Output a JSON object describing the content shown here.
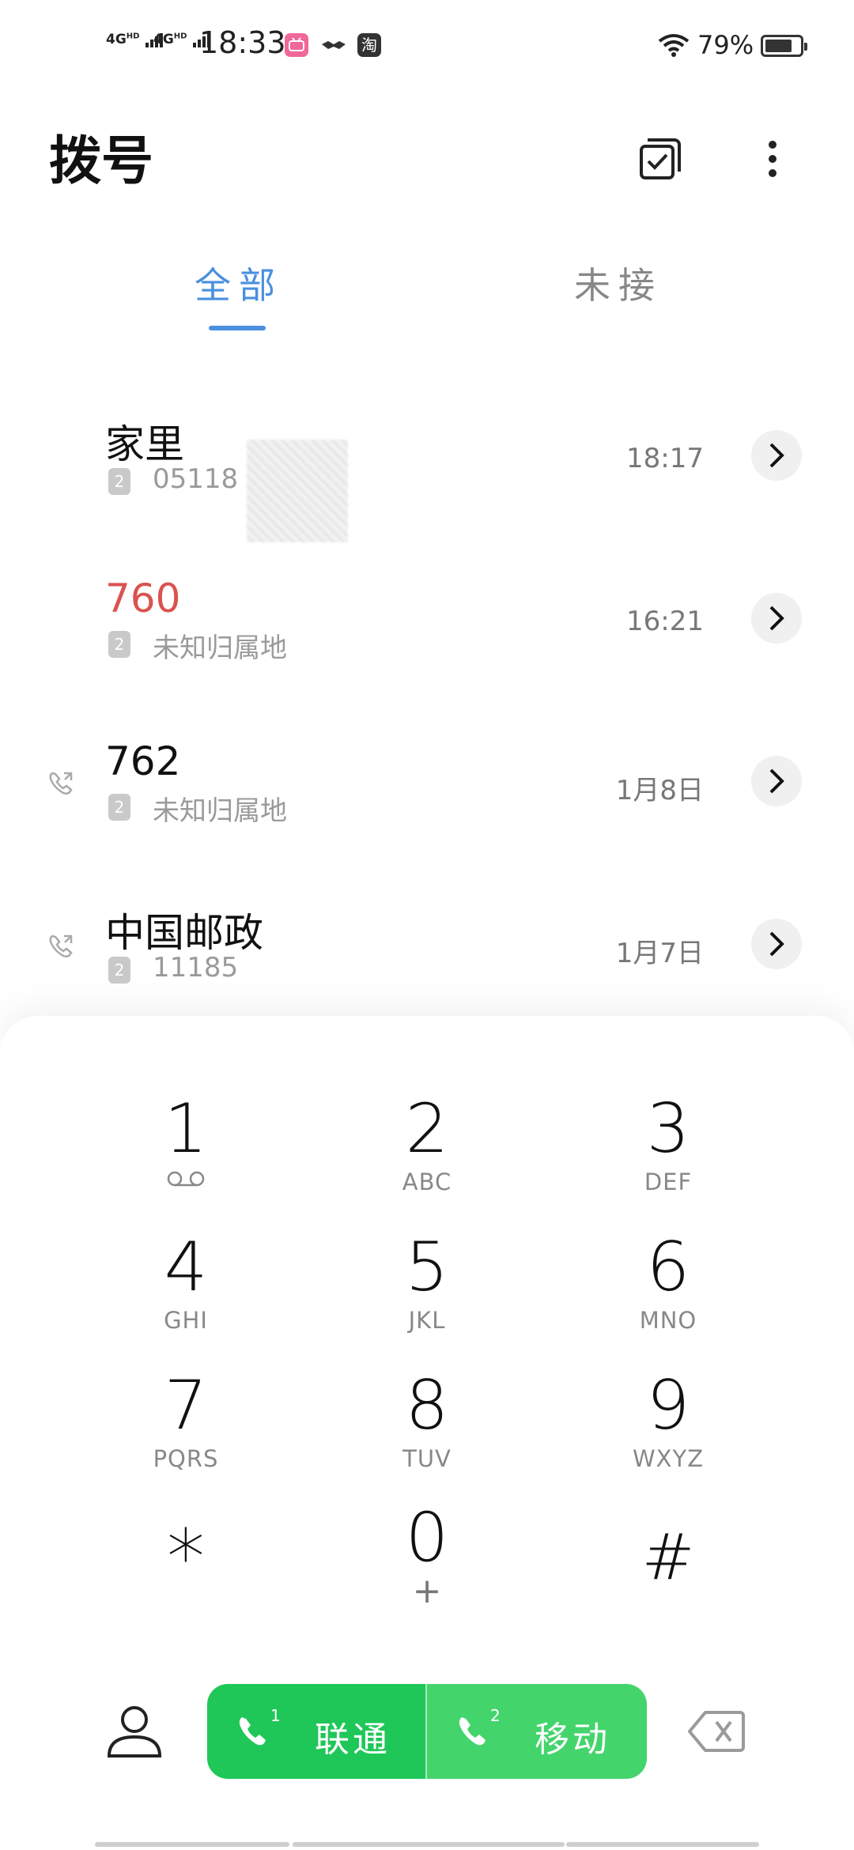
{
  "status_bar": {
    "signal1": "4G",
    "signal1_sup": "HD",
    "signal2": "4G",
    "signal2_sup": "HD",
    "time": "18:33",
    "battery_percent": "79%",
    "battery_level": 0.79,
    "app_icons": [
      "bilibili-icon",
      "handshake-icon",
      "taobao-icon"
    ],
    "taobao_char": "淘"
  },
  "header": {
    "title": "拨号",
    "multiselect_icon": "multiselect-icon",
    "more_icon": "more-vertical-icon"
  },
  "tabs": [
    {
      "label": "全部",
      "active": true
    },
    {
      "label": "未接",
      "active": false
    }
  ],
  "calls": [
    {
      "name": "家里",
      "sim": "2",
      "detail": "05118",
      "time": "18:17",
      "missed": false,
      "outgoing": false
    },
    {
      "name": "760",
      "sim": "2",
      "detail": "未知归属地",
      "time": "16:21",
      "missed": true,
      "outgoing": false
    },
    {
      "name": "762",
      "sim": "2",
      "detail": "未知归属地",
      "time": "1月8日",
      "missed": false,
      "outgoing": true
    },
    {
      "name": "中国邮政",
      "sim": "2",
      "detail": "11185",
      "time": "1月7日",
      "missed": false,
      "outgoing": true
    }
  ],
  "keypad": [
    {
      "digit": "1",
      "letters": "",
      "voicemail": true
    },
    {
      "digit": "2",
      "letters": "ABC"
    },
    {
      "digit": "3",
      "letters": "DEF"
    },
    {
      "digit": "4",
      "letters": "GHI"
    },
    {
      "digit": "5",
      "letters": "JKL"
    },
    {
      "digit": "6",
      "letters": "MNO"
    },
    {
      "digit": "7",
      "letters": "PQRS"
    },
    {
      "digit": "8",
      "letters": "TUV"
    },
    {
      "digit": "9",
      "letters": "WXYZ"
    },
    {
      "digit": "*",
      "letters": ""
    },
    {
      "digit": "0",
      "letters": "+"
    },
    {
      "digit": "#",
      "letters": ""
    }
  ],
  "call_buttons": [
    {
      "sim": "1",
      "label": "联通"
    },
    {
      "sim": "2",
      "label": "移动"
    }
  ],
  "colors": {
    "accent": "#4a8fe0",
    "missed": "#d9534f",
    "call_green": "#1fc758",
    "call_green_light": "#44d46c"
  }
}
